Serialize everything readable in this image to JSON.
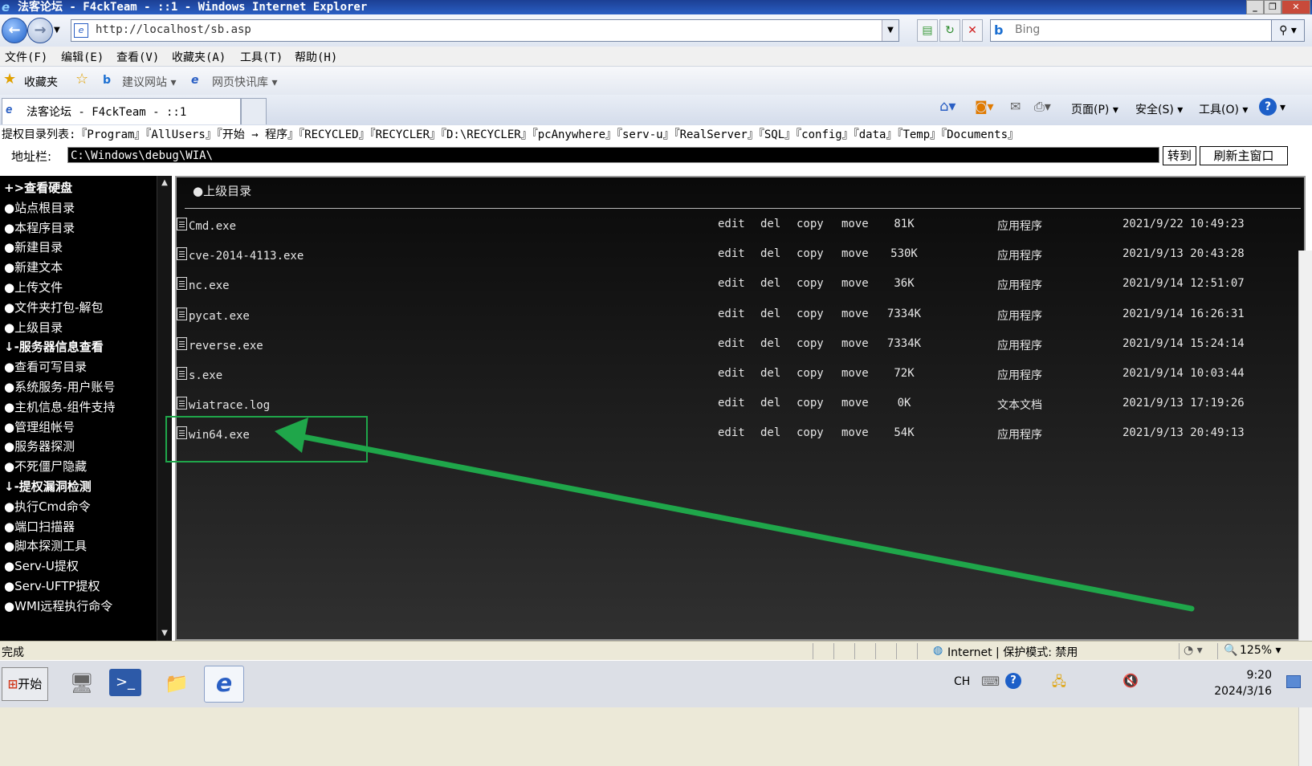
{
  "window": {
    "title": "法客论坛 - F4ckTeam - ::1 - Windows Internet Explorer",
    "minimize_glyph": "_",
    "restore_glyph": "❐",
    "close_glyph": "✕"
  },
  "navbar": {
    "url": "http://localhost/sb.asp",
    "search_placeholder": "Bing"
  },
  "menubar": {
    "items": [
      "文件(F)",
      "编辑(E)",
      "查看(V)",
      "收藏夹(A)",
      "工具(T)",
      "帮助(H)"
    ]
  },
  "favorites_bar": {
    "favorites_label": "收藏夹",
    "suggested_sites": "建议网站 ▾",
    "web_slice_gallery": "网页快讯库 ▾"
  },
  "tabs": {
    "active_tab_title": "法客论坛 - F4ckTeam - ::1"
  },
  "command_bar": {
    "page": "页面(P) ▾",
    "safety": "安全(S) ▾",
    "tools": "工具(O) ▾"
  },
  "webpage": {
    "quick_dirs": "提权目录列表:『Program』『AllUsers』『开始 → 程序』『RECYCLED』『RECYCLER』『D:\\RECYCLER』『pcAnywhere』『serv-u』『RealServer』『SQL』『config』『data』『Temp』『Documents』",
    "address_label": "地址栏:",
    "path_value": "C:\\Windows\\debug\\WIA\\",
    "go_button": "转到",
    "refresh_button": "刷新主窗口",
    "left_nav": [
      {
        "label": "+>查看硬盘",
        "header": true
      },
      {
        "label": "●站点根目录",
        "header": false
      },
      {
        "label": "●本程序目录",
        "header": false
      },
      {
        "label": "●新建目录",
        "header": false
      },
      {
        "label": "●新建文本",
        "header": false
      },
      {
        "label": "●上传文件",
        "header": false
      },
      {
        "label": "●文件夹打包-解包",
        "header": false
      },
      {
        "label": "●上级目录",
        "header": false
      },
      {
        "label": "↓-服务器信息查看",
        "header": true
      },
      {
        "label": "●查看可写目录",
        "header": false
      },
      {
        "label": "●系统服务-用户账号",
        "header": false
      },
      {
        "label": "●主机信息-组件支持",
        "header": false
      },
      {
        "label": "●管理组帐号",
        "header": false
      },
      {
        "label": "●服务器探测",
        "header": false
      },
      {
        "label": "●不死僵尸隐藏",
        "header": false
      },
      {
        "label": "↓-提权漏洞检测",
        "header": true
      },
      {
        "label": "●执行Cmd命令",
        "header": false
      },
      {
        "label": "●端口扫描器",
        "header": false
      },
      {
        "label": "●脚本探测工具",
        "header": false
      },
      {
        "label": "●Serv-U提权",
        "header": false
      },
      {
        "label": "●Serv-UFTP提权",
        "header": false
      },
      {
        "label": "●WMI远程执行命令",
        "header": false
      }
    ],
    "up_dir": "●上级目录",
    "actions": {
      "edit": "edit",
      "del": "del",
      "copy": "copy",
      "move": "move"
    },
    "files": [
      {
        "name": "Cmd.exe",
        "size": "81K",
        "type": "应用程序",
        "modified": "2021/9/22 10:49:23"
      },
      {
        "name": "cve-2014-4113.exe",
        "size": "530K",
        "type": "应用程序",
        "modified": "2021/9/13 20:43:28"
      },
      {
        "name": "nc.exe",
        "size": "36K",
        "type": "应用程序",
        "modified": "2021/9/14 12:51:07"
      },
      {
        "name": "pycat.exe",
        "size": "7334K",
        "type": "应用程序",
        "modified": "2021/9/14 16:26:31"
      },
      {
        "name": "reverse.exe",
        "size": "7334K",
        "type": "应用程序",
        "modified": "2021/9/14 15:24:14"
      },
      {
        "name": "s.exe",
        "size": "72K",
        "type": "应用程序",
        "modified": "2021/9/14 10:03:44"
      },
      {
        "name": "wiatrace.log",
        "size": "0K",
        "type": "文本文档",
        "modified": "2021/9/13 17:19:26"
      },
      {
        "name": "win64.exe",
        "size": "54K",
        "type": "应用程序",
        "modified": "2021/9/13 20:49:13"
      }
    ],
    "annotation_color": "#1fa64a"
  },
  "statusbar": {
    "status": "完成",
    "zone": "Internet | 保护模式: 禁用",
    "zoom": "125% ▾"
  },
  "taskbar": {
    "start_label": "开始",
    "lang": "CH",
    "time": "9:20",
    "date": "2024/3/16"
  }
}
